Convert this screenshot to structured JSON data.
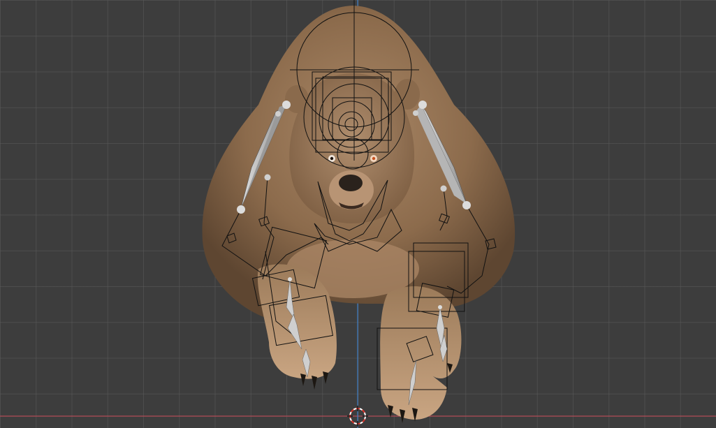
{
  "viewport": {
    "name": "3D Viewport",
    "background_color": "#3d3d3d",
    "grid_color": "#555555",
    "x_axis_color": "#b34b57",
    "z_axis_color": "#3f7fc4"
  },
  "scene": {
    "object": "bear",
    "model_color": "#9a7a58",
    "armature_color": "#111111",
    "bone_color": "#bdbdbd",
    "cursor": "3d-cursor"
  }
}
